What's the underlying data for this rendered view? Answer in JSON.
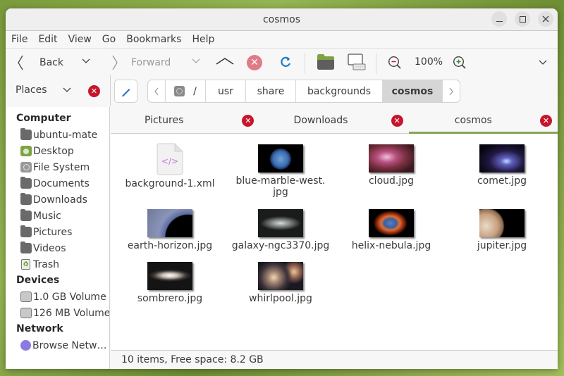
{
  "window": {
    "title": "cosmos",
    "controls": {
      "minimize": "minimize-icon",
      "maximize": "maximize-icon",
      "close": "close-icon"
    }
  },
  "menubar": [
    "File",
    "Edit",
    "View",
    "Go",
    "Bookmarks",
    "Help"
  ],
  "toolbar": {
    "back_label": "Back",
    "forward_label": "Forward",
    "zoom_level": "100%",
    "icons": [
      "back-chevron-icon",
      "back-history-dropdown-icon",
      "forward-chevron-icon",
      "forward-history-dropdown-icon",
      "up-icon",
      "stop-icon",
      "reload-icon",
      "home-folder-icon",
      "computer-icon",
      "zoom-out-icon",
      "zoom-in-icon",
      "more-dropdown-icon"
    ]
  },
  "places": {
    "label": "Places"
  },
  "breadcrumbs": [
    {
      "label": "/",
      "icon": "filesystem-icon"
    },
    {
      "label": "usr"
    },
    {
      "label": "share"
    },
    {
      "label": "backgrounds"
    },
    {
      "label": "cosmos",
      "active": true
    }
  ],
  "sidebar": {
    "sections": [
      {
        "title": "Computer",
        "items": [
          {
            "label": "ubuntu-mate",
            "icon": "folder-icon"
          },
          {
            "label": "Desktop",
            "icon": "desktop-icon"
          },
          {
            "label": "File System",
            "icon": "filesystem-icon"
          },
          {
            "label": "Documents",
            "icon": "folder-icon"
          },
          {
            "label": "Downloads",
            "icon": "folder-icon"
          },
          {
            "label": "Music",
            "icon": "folder-icon"
          },
          {
            "label": "Pictures",
            "icon": "folder-icon"
          },
          {
            "label": "Videos",
            "icon": "folder-icon"
          },
          {
            "label": "Trash",
            "icon": "trash-icon"
          }
        ]
      },
      {
        "title": "Devices",
        "items": [
          {
            "label": "1.0 GB Volume",
            "icon": "drive-icon"
          },
          {
            "label": "126 MB Volume",
            "icon": "drive-icon"
          }
        ]
      },
      {
        "title": "Network",
        "items": [
          {
            "label": "Browse Netw…",
            "icon": "network-icon"
          }
        ]
      }
    ]
  },
  "tabs": [
    {
      "label": "Pictures",
      "active": false
    },
    {
      "label": "Downloads",
      "active": false
    },
    {
      "label": "cosmos",
      "active": true
    }
  ],
  "files": [
    {
      "name": "background-1.xml",
      "type": "xml"
    },
    {
      "name": "blue-marble-west.\njpg",
      "type": "image"
    },
    {
      "name": "cloud.jpg",
      "type": "image"
    },
    {
      "name": "comet.jpg",
      "type": "image"
    },
    {
      "name": "earth-horizon.jpg",
      "type": "image"
    },
    {
      "name": "galaxy-ngc3370.jpg",
      "type": "image"
    },
    {
      "name": "helix-nebula.jpg",
      "type": "image"
    },
    {
      "name": "jupiter.jpg",
      "type": "image"
    },
    {
      "name": "sombrero.jpg",
      "type": "image"
    },
    {
      "name": "whirlpool.jpg",
      "type": "image"
    }
  ],
  "status": "10 items, Free space: 8.2 GB",
  "colors": {
    "accent": "#87a556",
    "close_red": "#c7162b",
    "stop_pink": "#e07b88",
    "reload_blue": "#1e7bc8"
  }
}
